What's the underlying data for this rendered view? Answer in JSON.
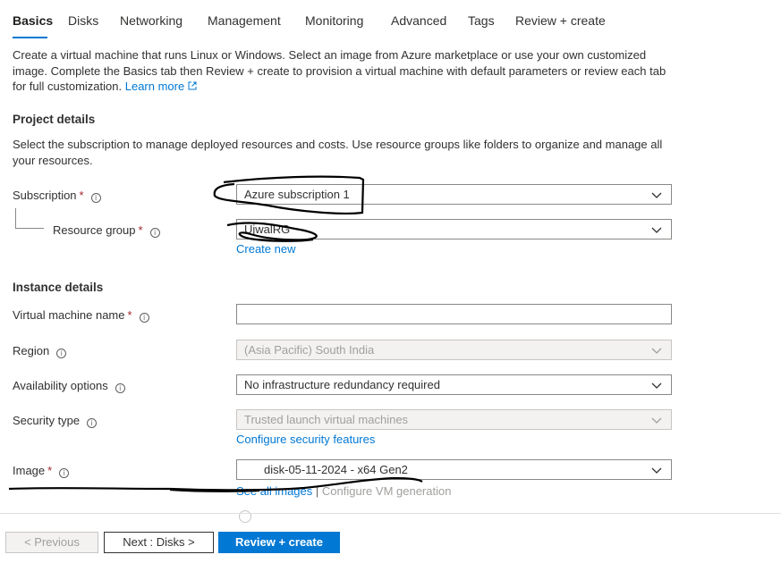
{
  "tabs": [
    {
      "label": "Basics",
      "active": true
    },
    {
      "label": "Disks"
    },
    {
      "label": "Networking"
    },
    {
      "label": "Management"
    },
    {
      "label": "Monitoring"
    },
    {
      "label": "Advanced"
    },
    {
      "label": "Tags"
    },
    {
      "label": "Review + create"
    }
  ],
  "intro": {
    "text": "Create a virtual machine that runs Linux or Windows. Select an image from Azure marketplace or use your own customized image. Complete the Basics tab then Review + create to provision a virtual machine with default parameters or review each tab for full customization.",
    "learn_more": "Learn more"
  },
  "project": {
    "title": "Project details",
    "desc": "Select the subscription to manage deployed resources and costs. Use resource groups like folders to organize and manage all your resources.",
    "subscription_label": "Subscription",
    "subscription_value": "Azure subscription 1",
    "rg_label": "Resource group",
    "rg_value": "UjwalRG",
    "create_new": "Create new"
  },
  "instance": {
    "title": "Instance details",
    "vm_name_label": "Virtual machine name",
    "vm_name_value": "",
    "region_label": "Region",
    "region_value": "(Asia Pacific) South India",
    "availability_label": "Availability options",
    "availability_value": "No infrastructure redundancy required",
    "security_label": "Security type",
    "security_value": "Trusted launch virtual machines",
    "configure_security": "Configure security features",
    "image_label": "Image",
    "image_value": "disk-05-11-2024 - x64 Gen2",
    "see_all_images": "See all images",
    "separator": "|",
    "configure_vm_gen": "Configure VM generation"
  },
  "required_mark": "*",
  "info_glyph": "i",
  "footer": {
    "previous": "< Previous",
    "next": "Next : Disks >",
    "review_create": "Review + create"
  },
  "colors": {
    "accent": "#0078d4",
    "required": "#a4262c",
    "disabled_bg": "#f3f2f1"
  }
}
